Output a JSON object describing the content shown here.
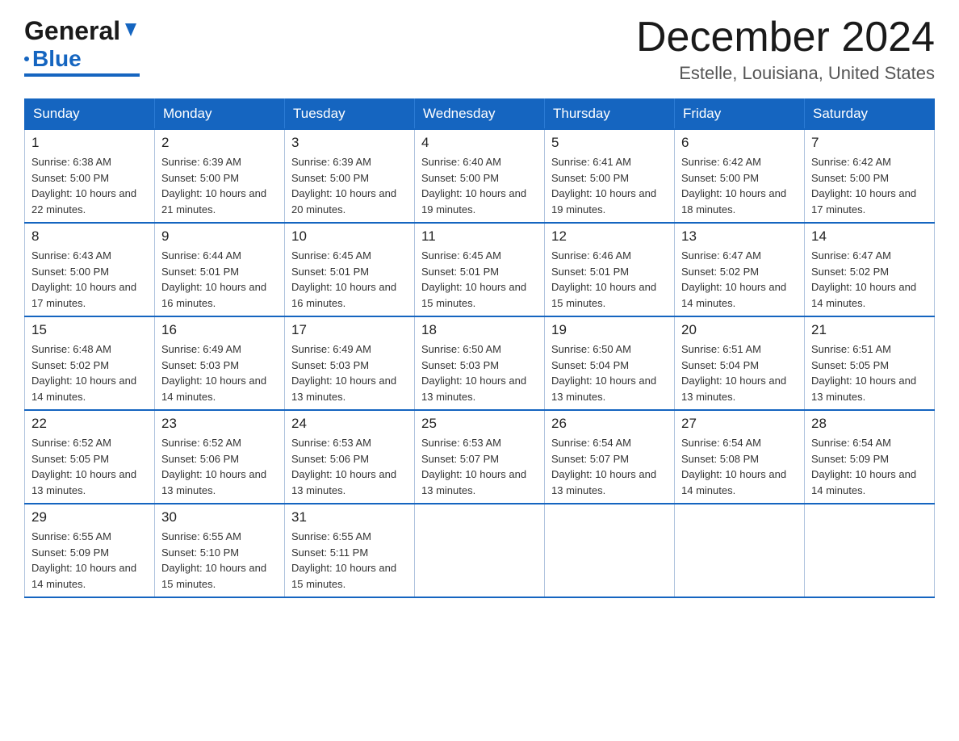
{
  "logo": {
    "general": "General",
    "blue": "Blue"
  },
  "header": {
    "month_title": "December 2024",
    "location": "Estelle, Louisiana, United States"
  },
  "days_of_week": [
    "Sunday",
    "Monday",
    "Tuesday",
    "Wednesday",
    "Thursday",
    "Friday",
    "Saturday"
  ],
  "weeks": [
    [
      {
        "day": "1",
        "sunrise": "6:38 AM",
        "sunset": "5:00 PM",
        "daylight": "10 hours and 22 minutes."
      },
      {
        "day": "2",
        "sunrise": "6:39 AM",
        "sunset": "5:00 PM",
        "daylight": "10 hours and 21 minutes."
      },
      {
        "day": "3",
        "sunrise": "6:39 AM",
        "sunset": "5:00 PM",
        "daylight": "10 hours and 20 minutes."
      },
      {
        "day": "4",
        "sunrise": "6:40 AM",
        "sunset": "5:00 PM",
        "daylight": "10 hours and 19 minutes."
      },
      {
        "day": "5",
        "sunrise": "6:41 AM",
        "sunset": "5:00 PM",
        "daylight": "10 hours and 19 minutes."
      },
      {
        "day": "6",
        "sunrise": "6:42 AM",
        "sunset": "5:00 PM",
        "daylight": "10 hours and 18 minutes."
      },
      {
        "day": "7",
        "sunrise": "6:42 AM",
        "sunset": "5:00 PM",
        "daylight": "10 hours and 17 minutes."
      }
    ],
    [
      {
        "day": "8",
        "sunrise": "6:43 AM",
        "sunset": "5:00 PM",
        "daylight": "10 hours and 17 minutes."
      },
      {
        "day": "9",
        "sunrise": "6:44 AM",
        "sunset": "5:01 PM",
        "daylight": "10 hours and 16 minutes."
      },
      {
        "day": "10",
        "sunrise": "6:45 AM",
        "sunset": "5:01 PM",
        "daylight": "10 hours and 16 minutes."
      },
      {
        "day": "11",
        "sunrise": "6:45 AM",
        "sunset": "5:01 PM",
        "daylight": "10 hours and 15 minutes."
      },
      {
        "day": "12",
        "sunrise": "6:46 AM",
        "sunset": "5:01 PM",
        "daylight": "10 hours and 15 minutes."
      },
      {
        "day": "13",
        "sunrise": "6:47 AM",
        "sunset": "5:02 PM",
        "daylight": "10 hours and 14 minutes."
      },
      {
        "day": "14",
        "sunrise": "6:47 AM",
        "sunset": "5:02 PM",
        "daylight": "10 hours and 14 minutes."
      }
    ],
    [
      {
        "day": "15",
        "sunrise": "6:48 AM",
        "sunset": "5:02 PM",
        "daylight": "10 hours and 14 minutes."
      },
      {
        "day": "16",
        "sunrise": "6:49 AM",
        "sunset": "5:03 PM",
        "daylight": "10 hours and 14 minutes."
      },
      {
        "day": "17",
        "sunrise": "6:49 AM",
        "sunset": "5:03 PM",
        "daylight": "10 hours and 13 minutes."
      },
      {
        "day": "18",
        "sunrise": "6:50 AM",
        "sunset": "5:03 PM",
        "daylight": "10 hours and 13 minutes."
      },
      {
        "day": "19",
        "sunrise": "6:50 AM",
        "sunset": "5:04 PM",
        "daylight": "10 hours and 13 minutes."
      },
      {
        "day": "20",
        "sunrise": "6:51 AM",
        "sunset": "5:04 PM",
        "daylight": "10 hours and 13 minutes."
      },
      {
        "day": "21",
        "sunrise": "6:51 AM",
        "sunset": "5:05 PM",
        "daylight": "10 hours and 13 minutes."
      }
    ],
    [
      {
        "day": "22",
        "sunrise": "6:52 AM",
        "sunset": "5:05 PM",
        "daylight": "10 hours and 13 minutes."
      },
      {
        "day": "23",
        "sunrise": "6:52 AM",
        "sunset": "5:06 PM",
        "daylight": "10 hours and 13 minutes."
      },
      {
        "day": "24",
        "sunrise": "6:53 AM",
        "sunset": "5:06 PM",
        "daylight": "10 hours and 13 minutes."
      },
      {
        "day": "25",
        "sunrise": "6:53 AM",
        "sunset": "5:07 PM",
        "daylight": "10 hours and 13 minutes."
      },
      {
        "day": "26",
        "sunrise": "6:54 AM",
        "sunset": "5:07 PM",
        "daylight": "10 hours and 13 minutes."
      },
      {
        "day": "27",
        "sunrise": "6:54 AM",
        "sunset": "5:08 PM",
        "daylight": "10 hours and 14 minutes."
      },
      {
        "day": "28",
        "sunrise": "6:54 AM",
        "sunset": "5:09 PM",
        "daylight": "10 hours and 14 minutes."
      }
    ],
    [
      {
        "day": "29",
        "sunrise": "6:55 AM",
        "sunset": "5:09 PM",
        "daylight": "10 hours and 14 minutes."
      },
      {
        "day": "30",
        "sunrise": "6:55 AM",
        "sunset": "5:10 PM",
        "daylight": "10 hours and 15 minutes."
      },
      {
        "day": "31",
        "sunrise": "6:55 AM",
        "sunset": "5:11 PM",
        "daylight": "10 hours and 15 minutes."
      },
      null,
      null,
      null,
      null
    ]
  ],
  "labels": {
    "sunrise": "Sunrise:",
    "sunset": "Sunset:",
    "daylight": "Daylight:"
  }
}
